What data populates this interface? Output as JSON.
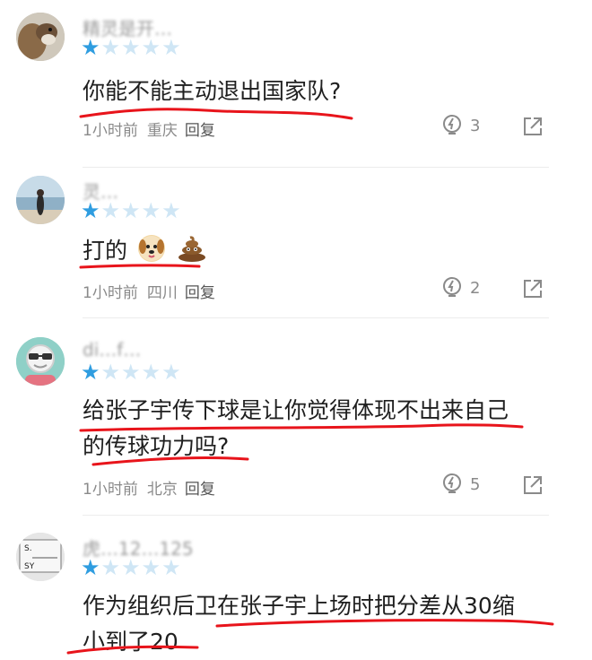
{
  "comments": [
    {
      "username": "精灵是开…",
      "stars_filled": 1,
      "stars_total": 5,
      "lines": [
        "你能不能主动退出国家队?"
      ],
      "time": "1小时前",
      "location": "重庆",
      "reply_label": "回复",
      "likes": "3",
      "avatar": "squirrel-avatar"
    },
    {
      "username": "灵…",
      "stars_filled": 1,
      "stars_total": 5,
      "lines": [
        "打的"
      ],
      "emojis": [
        "dog-face-emoji",
        "pile-of-poo-emoji"
      ],
      "time": "1小时前",
      "location": "四川",
      "reply_label": "回复",
      "likes": "2",
      "avatar": "beach-photo-avatar"
    },
    {
      "username": "di…f…",
      "stars_filled": 1,
      "stars_total": 5,
      "lines": [
        "给张子宇传下球是让你觉得体现不出来自己",
        "的传球功力吗?"
      ],
      "time": "1小时前",
      "location": "北京",
      "reply_label": "回复",
      "likes": "5",
      "avatar": "grandpa-sunglasses-avatar"
    },
    {
      "username": "虎…12…125",
      "stars_filled": 1,
      "stars_total": 5,
      "lines": [
        "作为组织后卫在张子宇上场时把分差从30缩",
        "小到了20"
      ],
      "avatar": "sticker-avatar"
    }
  ],
  "colors": {
    "star_on": "#2f9de0",
    "star_off": "#cfe6f5",
    "underline": "#e8141b",
    "meta": "#8a8a8a"
  }
}
